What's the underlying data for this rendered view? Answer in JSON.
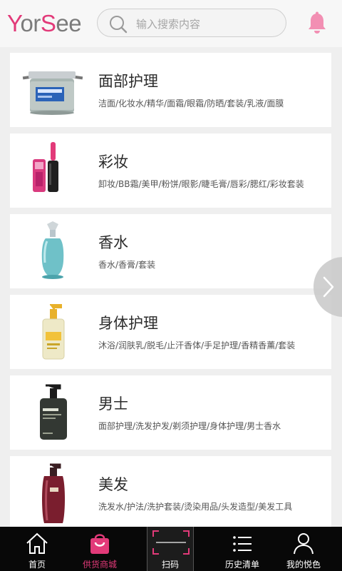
{
  "header": {
    "logo": {
      "p1": "Y",
      "p2": "or",
      "p3": "S",
      "p4": "ee"
    },
    "search_placeholder": "输入搜索内容"
  },
  "categories": [
    {
      "title": "面部护理",
      "subtitle": "洁面/化妆水/精华/面霜/眼霜/防晒/套装/乳液/面膜",
      "image": "face-cream-jar"
    },
    {
      "title": "彩妆",
      "subtitle": "卸妆/BB霜/美甲/粉饼/眼影/睫毛膏/唇彩/腮红/彩妆套装",
      "image": "lip-gloss"
    },
    {
      "title": "香水",
      "subtitle": "香水/香膏/套装",
      "image": "perfume-bottle"
    },
    {
      "title": "身体护理",
      "subtitle": "沐浴/润肤乳/脱毛/止汗香体/手足护理/香精香薰/套装",
      "image": "lotion-pump"
    },
    {
      "title": "男士",
      "subtitle": "面部护理/洗发护发/剃须护理/身体护理/男士香水",
      "image": "men-cleanser"
    },
    {
      "title": "美发",
      "subtitle": "洗发水/护法/洗护套装/烫染用品/头发造型/美发工具",
      "image": "shampoo-bottle"
    }
  ],
  "tabbar": [
    {
      "label": "首页",
      "icon": "home-icon"
    },
    {
      "label": "供货商城",
      "icon": "shopping-bag-icon",
      "active": true
    },
    {
      "label": "扫码",
      "icon": "scan-icon"
    },
    {
      "label": "历史清单",
      "icon": "list-icon"
    },
    {
      "label": "我的悦色",
      "icon": "user-icon"
    }
  ],
  "colors": {
    "accent": "#e23a79",
    "tabbar_bg": "#080808",
    "page_bg": "#efefef"
  }
}
